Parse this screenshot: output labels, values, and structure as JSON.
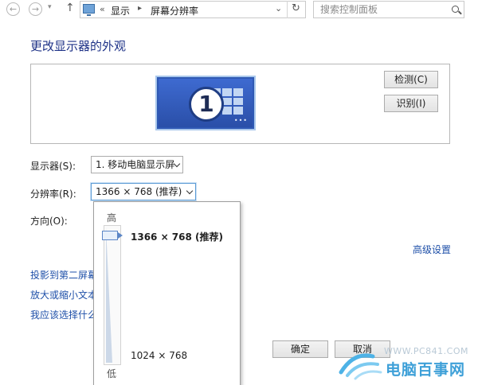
{
  "nav": {
    "back_icon": "left-arrow-icon",
    "forward_icon": "right-arrow-icon",
    "up_icon": "up-arrow-icon",
    "breadcrumb_sep": "«",
    "breadcrumb_1": "显示",
    "breadcrumb_arrow": "▸",
    "breadcrumb_2": "屏幕分辨率",
    "refresh_icon": "refresh-icon",
    "search_placeholder": "搜索控制面板"
  },
  "page": {
    "title": "更改显示器的外观"
  },
  "monitor": {
    "number": "1"
  },
  "buttons": {
    "detect": "检测(C)",
    "identify": "识别(I)",
    "ok": "确定",
    "cancel": "取消"
  },
  "settings": {
    "display_label": "显示器(S):",
    "display_value": "1. 移动电脑显示屏",
    "resolution_label": "分辨率(R):",
    "resolution_value": "1366 × 768 (推荐)",
    "orientation_label": "方向(O):",
    "advanced_link": "高级设置"
  },
  "links": {
    "project": "投影到第二屏幕",
    "enlarge": "放大或缩小文本",
    "choose": "我应该选择什么"
  },
  "resolution_popup": {
    "high": "高",
    "low": "低",
    "option_top": "1366 × 768 (推荐)",
    "option_bottom": "1024 × 768",
    "selected_fraction": 1.0
  },
  "watermark": {
    "url": "WWW.PC841.COM",
    "name": "电脑百事网"
  },
  "colors": {
    "title": "#1e3287",
    "link": "#1e4fa8",
    "monitor": "#2f59b4",
    "watermark": "#3ea0d8"
  }
}
